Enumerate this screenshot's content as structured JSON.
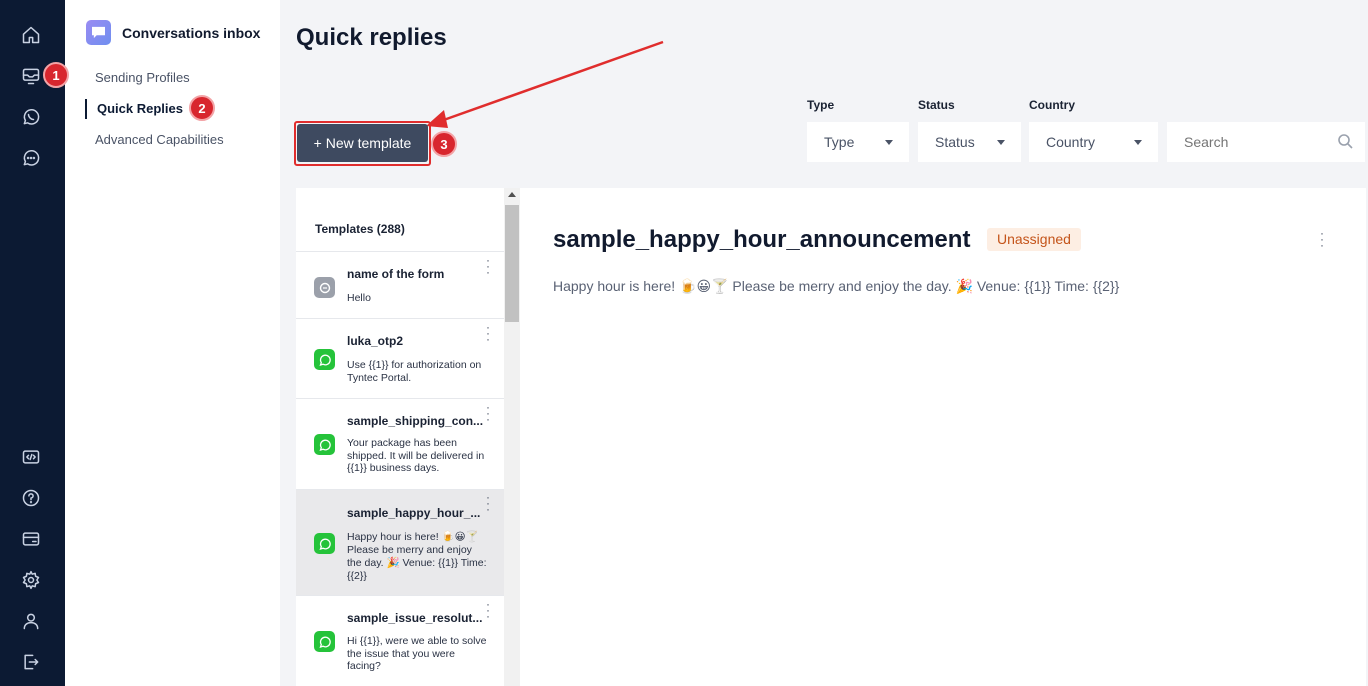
{
  "rail": {
    "icons": [
      "home-icon",
      "inbox-icon",
      "whatsapp-icon",
      "chat-icon",
      "code-icon",
      "help-icon",
      "billing-icon",
      "settings-icon",
      "user-icon",
      "logout-icon"
    ]
  },
  "subnav": {
    "title": "Conversations inbox",
    "items": [
      {
        "label": "Sending Profiles"
      },
      {
        "label": "Quick Replies"
      },
      {
        "label": "Advanced Capabilities"
      }
    ]
  },
  "badges": [
    "1",
    "2",
    "3"
  ],
  "page": {
    "title": "Quick replies",
    "new_button": "+ New template"
  },
  "filters": {
    "type_label": "Type",
    "type_value": "Type",
    "status_label": "Status",
    "status_value": "Status",
    "country_label": "Country",
    "country_value": "Country",
    "search_placeholder": "Search"
  },
  "list": {
    "header": "Templates (288)",
    "items": [
      {
        "name": "name of the form",
        "desc_lines": [
          "Hello"
        ],
        "icon": "form-icon"
      },
      {
        "name": "luka_otp2",
        "desc_lines": [
          "Use {{1}} for authorization on",
          "Tyntec Portal."
        ],
        "icon": "whatsapp-icon"
      },
      {
        "name": "sample_shipping_con...",
        "desc_lines": [
          "Your package has been",
          "shipped. It will be delivered in",
          "{{1}} business days."
        ],
        "icon": "whatsapp-icon"
      },
      {
        "name": "sample_happy_hour_...",
        "desc_lines": [
          "Happy hour is here! 🍺😀🍸",
          "Please be merry and enjoy",
          "the day. 🎉 Venue: {{1}} Time:",
          "{{2}}"
        ],
        "icon": "whatsapp-icon"
      },
      {
        "name": "sample_issue_resolut...",
        "desc_lines": [
          "Hi {{1}}, were we able to solve",
          "the issue that you were",
          "facing?"
        ],
        "icon": "whatsapp-icon"
      }
    ]
  },
  "detail": {
    "title": "sample_happy_hour_announcement",
    "status": "Unassigned",
    "body": "Happy hour is here! 🍺😀🍸 Please be merry and enjoy the day. 🎉 Venue: {{1}} Time: {{2}}"
  },
  "colors": {
    "rail_bg": "#0c1a33",
    "accent_button": "#3e4a60",
    "annotation_red": "#d8262e",
    "whatsapp_green": "#25c33a",
    "status_text": "#c4541a",
    "status_bg": "#fdeee3"
  }
}
